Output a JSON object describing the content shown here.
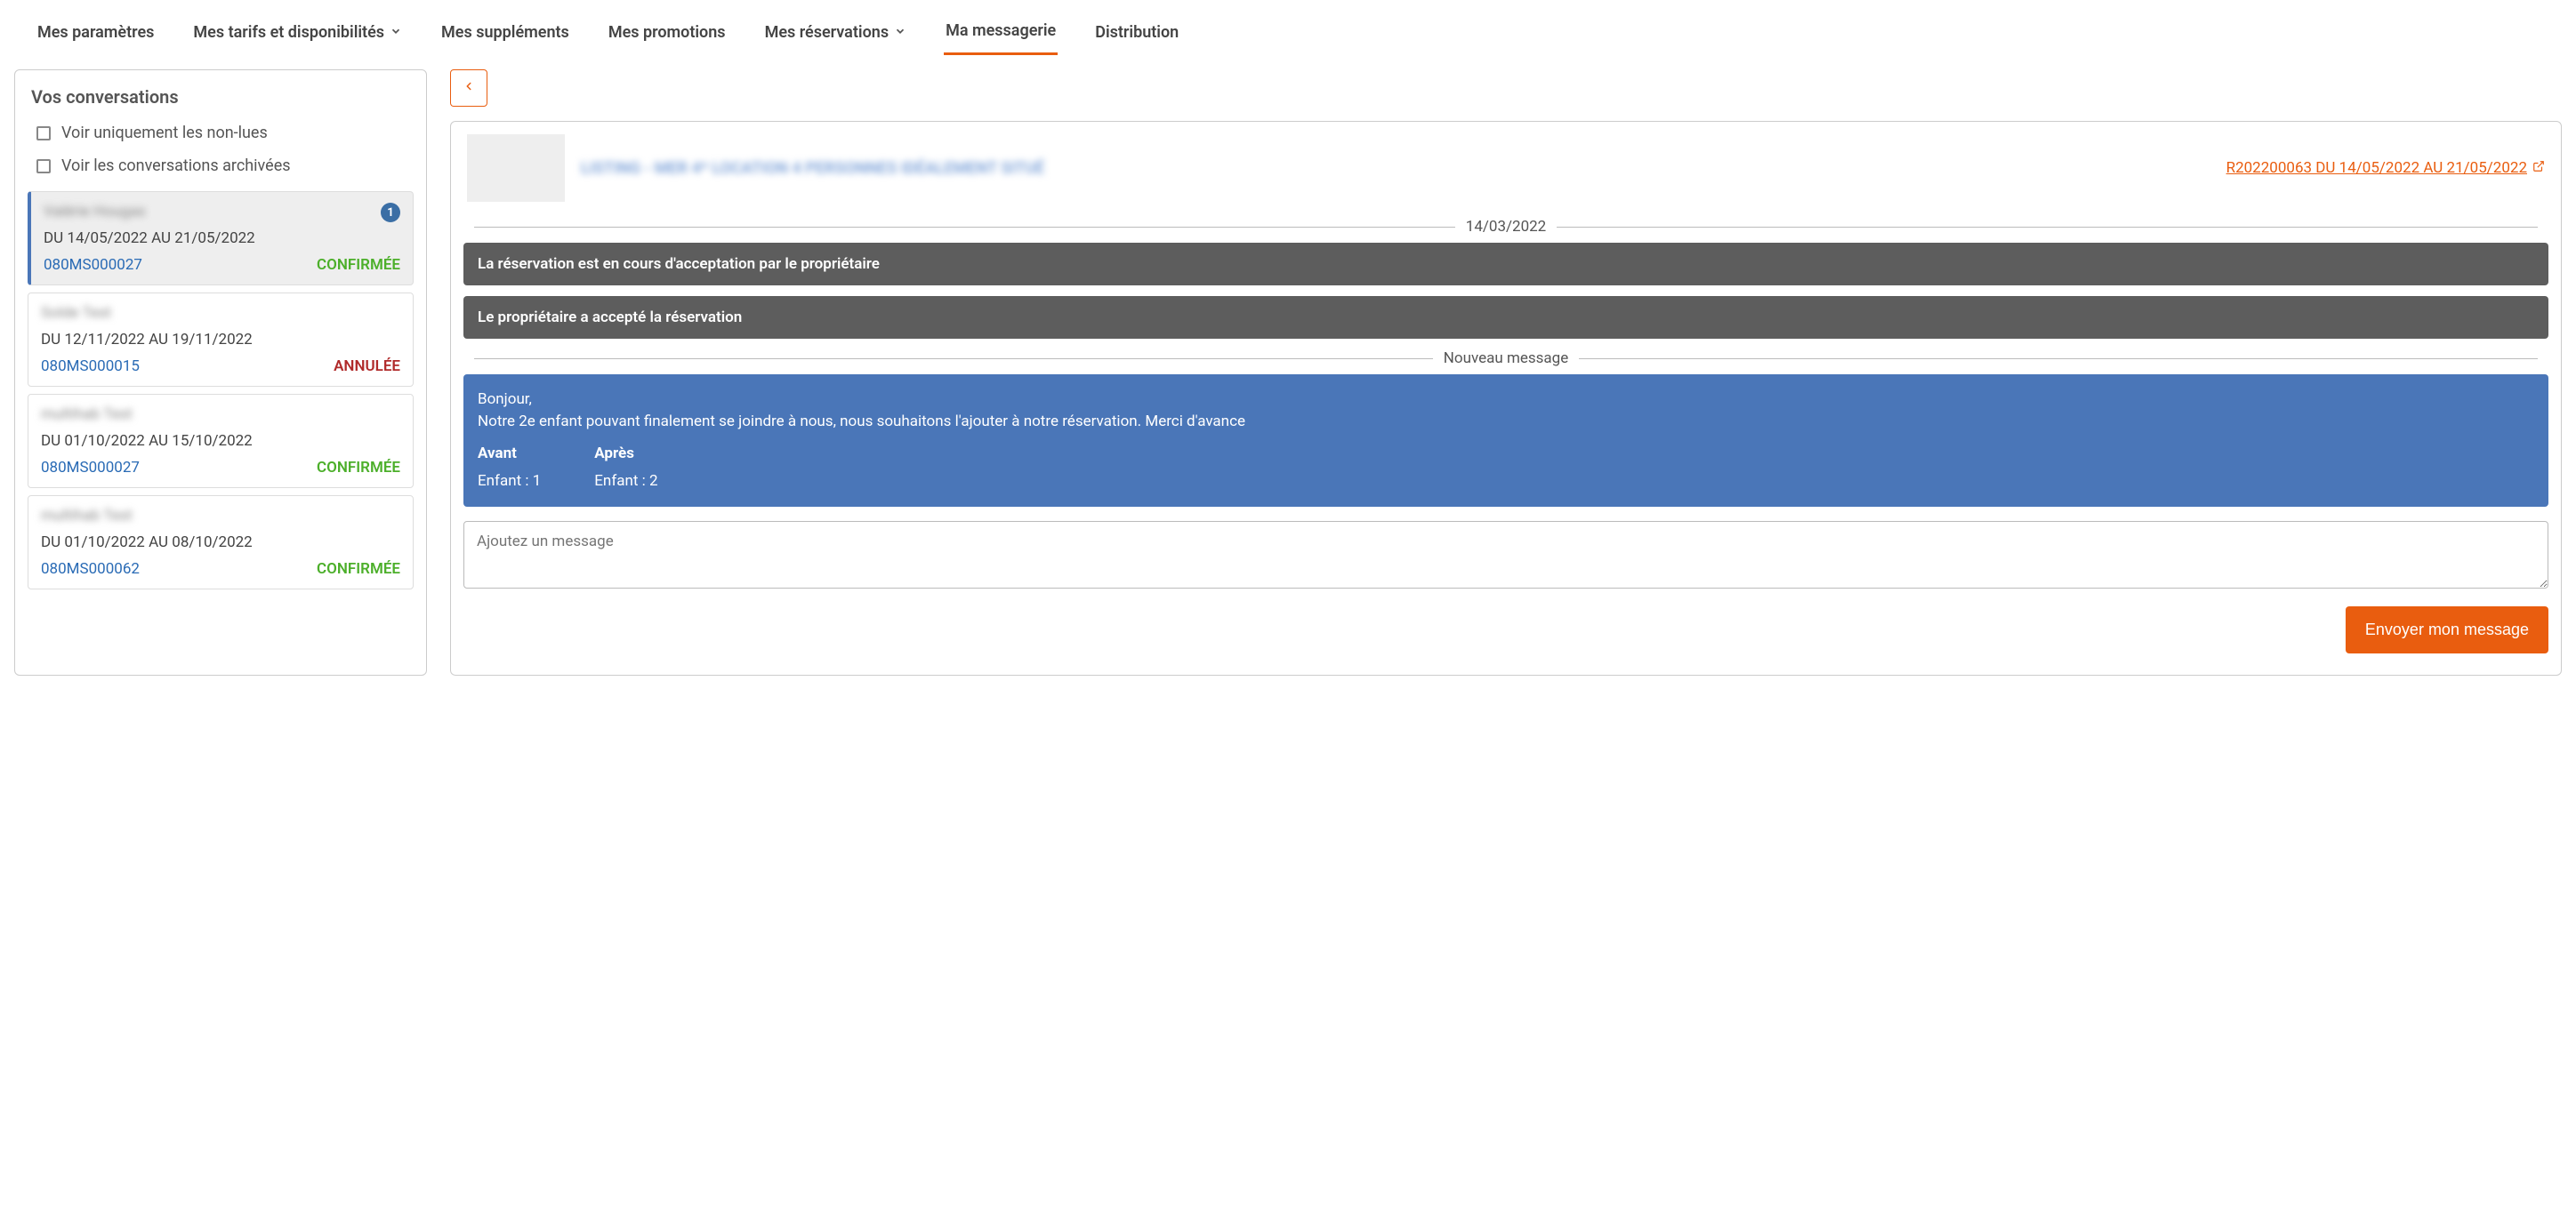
{
  "nav": {
    "tabs": [
      {
        "label": "Mes paramètres",
        "dropdown": false
      },
      {
        "label": "Mes tarifs et disponibilités",
        "dropdown": true
      },
      {
        "label": "Mes suppléments",
        "dropdown": false
      },
      {
        "label": "Mes promotions",
        "dropdown": false
      },
      {
        "label": "Mes réservations",
        "dropdown": true
      },
      {
        "label": "Ma messagerie",
        "dropdown": false,
        "active": true
      },
      {
        "label": "Distribution",
        "dropdown": false
      }
    ]
  },
  "sidebar": {
    "title": "Vos conversations",
    "filters": {
      "unread": "Voir uniquement les non-lues",
      "archived": "Voir les conversations archivées"
    },
    "items": [
      {
        "name": "Valérie Hougas",
        "dates": "DU 14/05/2022 AU 21/05/2022",
        "ref": "080MS000027",
        "status": "CONFIRMÉE",
        "status_type": "confirmed",
        "unread": 1,
        "selected": true
      },
      {
        "name": "Solde Test",
        "dates": "DU 12/11/2022 AU 19/11/2022",
        "ref": "080MS000015",
        "status": "ANNULÉE",
        "status_type": "cancelled"
      },
      {
        "name": "multihab Test",
        "dates": "DU 01/10/2022 AU 15/10/2022",
        "ref": "080MS000027",
        "status": "CONFIRMÉE",
        "status_type": "confirmed"
      },
      {
        "name": "multihab Test",
        "dates": "DU 01/10/2022 AU 08/10/2022",
        "ref": "080MS000062",
        "status": "CONFIRMÉE",
        "status_type": "confirmed"
      }
    ]
  },
  "thread": {
    "property_title": "LISTING - MER 4* LOCATION 4 PERSONNES IDÉALEMENT SITUÉ",
    "reservation_link": "R202200063 DU 14/05/2022 AU 21/05/2022",
    "date_separator": "14/03/2022",
    "system_msgs": [
      "La réservation est en cours d'acceptation par le propriétaire",
      "Le propriétaire a accepté la réservation"
    ],
    "newmsg_label": "Nouveau message",
    "newmsg": {
      "body": "Bonjour,\nNotre 2e enfant pouvant finalement se joindre à nous, nous souhaitons l'ajouter à notre réservation. Merci d'avance",
      "before_label": "Avant",
      "after_label": "Après",
      "before_value": "Enfant : 1",
      "after_value": "Enfant : 2"
    },
    "compose_placeholder": "Ajoutez un message",
    "send_label": "Envoyer mon message"
  }
}
